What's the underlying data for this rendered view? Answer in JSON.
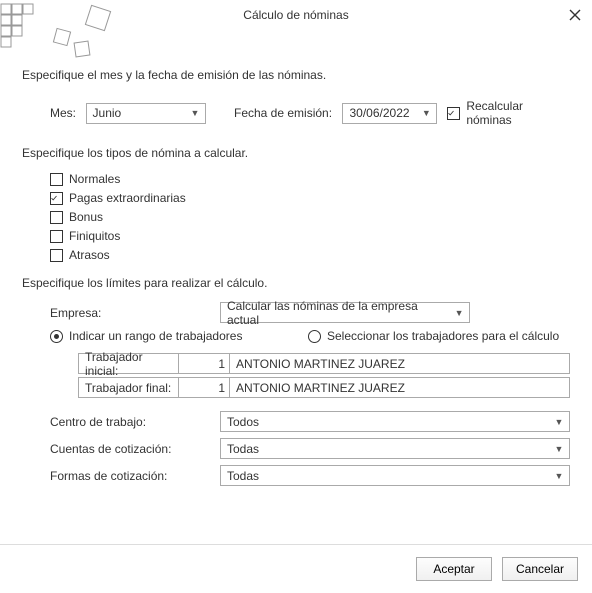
{
  "title": "Cálculo de nóminas",
  "section1": "Especifique el mes y la fecha de emisión de las nóminas.",
  "month_label": "Mes:",
  "month_value": "Junio",
  "emission_label": "Fecha de emisión:",
  "emission_value": "30/06/2022",
  "recalc_label": "Recalcular nóminas",
  "section2": "Especifique los tipos de nómina a calcular.",
  "types": {
    "normales": "Normales",
    "extra": "Pagas extraordinarias",
    "bonus": "Bonus",
    "finiquitos": "Finiquitos",
    "atrasos": "Atrasos"
  },
  "section3": "Especifique los límites para realizar el cálculo.",
  "empresa_label": "Empresa:",
  "empresa_value": "Calcular las nóminas de la empresa actual",
  "radio_range": "Indicar un rango de trabajadores",
  "radio_select": "Seleccionar los trabajadores para el cálculo",
  "worker_initial_label": "Trabajador inicial:",
  "worker_final_label": "Trabajador final:",
  "worker_num": "1",
  "worker_name": "ANTONIO MARTINEZ JUAREZ",
  "centro_label": "Centro de trabajo:",
  "centro_value": "Todos",
  "cuentas_label": "Cuentas de cotización:",
  "cuentas_value": "Todas",
  "formas_label": "Formas de cotización:",
  "formas_value": "Todas",
  "accept": "Aceptar",
  "cancel": "Cancelar"
}
